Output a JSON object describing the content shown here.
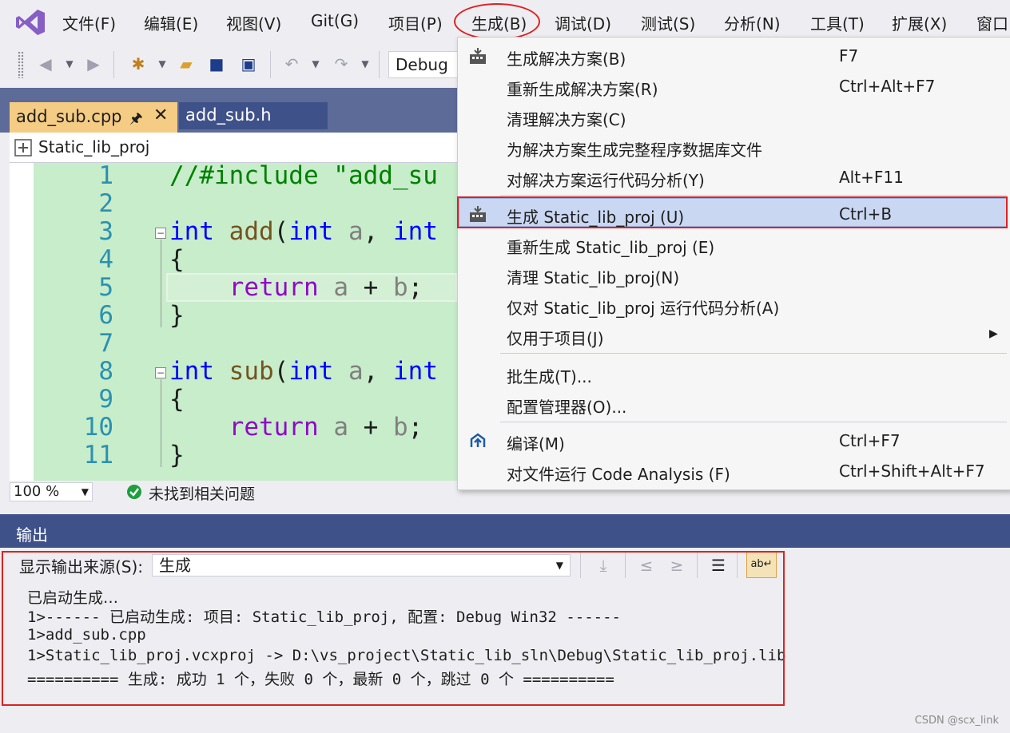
{
  "menubar": {
    "items": [
      "文件(F)",
      "编辑(E)",
      "视图(V)",
      "Git(G)",
      "项目(P)",
      "生成(B)",
      "调试(D)",
      "测试(S)",
      "分析(N)",
      "工具(T)",
      "扩展(X)",
      "窗口"
    ]
  },
  "toolbar": {
    "configuration": "Debug"
  },
  "tabs": [
    {
      "label": "add_sub.cpp",
      "active": true
    },
    {
      "label": "add_sub.h",
      "active": false
    }
  ],
  "navbar": {
    "project": "Static_lib_proj"
  },
  "editor": {
    "line_numbers": [
      "1",
      "2",
      "3",
      "4",
      "5",
      "6",
      "7",
      "8",
      "9",
      "10",
      "11"
    ]
  },
  "status": {
    "zoom": "100 %",
    "issues": "未找到相关问题"
  },
  "output": {
    "title": "输出",
    "source_label": "显示输出来源(S):",
    "source_value": "生成",
    "lines": [
      "已启动生成…",
      "1>------ 已启动生成: 项目: Static_lib_proj, 配置: Debug Win32 ------",
      "1>add_sub.cpp",
      "1>Static_lib_proj.vcxproj -> D:\\vs_project\\Static_lib_sln\\Debug\\Static_lib_proj.lib",
      "========== 生成: 成功 1 个，失败 0 个，最新 0 个，跳过 0 个 =========="
    ]
  },
  "build_menu": {
    "items": [
      {
        "label": "生成解决方案(B)",
        "shortcut": "F7"
      },
      {
        "label": "重新生成解决方案(R)",
        "shortcut": "Ctrl+Alt+F7"
      },
      {
        "label": "清理解决方案(C)",
        "shortcut": ""
      },
      {
        "label": "为解决方案生成完整程序数据库文件",
        "shortcut": ""
      },
      {
        "label": "对解决方案运行代码分析(Y)",
        "shortcut": "Alt+F11"
      },
      {
        "label": "生成 Static_lib_proj (U)",
        "shortcut": "Ctrl+B"
      },
      {
        "label": "重新生成 Static_lib_proj (E)",
        "shortcut": ""
      },
      {
        "label": "清理 Static_lib_proj(N)",
        "shortcut": ""
      },
      {
        "label": "仅对 Static_lib_proj 运行代码分析(A)",
        "shortcut": ""
      },
      {
        "label": "仅用于项目(J)",
        "shortcut": ""
      },
      {
        "label": "批生成(T)...",
        "shortcut": ""
      },
      {
        "label": "配置管理器(O)...",
        "shortcut": ""
      },
      {
        "label": "编译(M)",
        "shortcut": "Ctrl+F7"
      },
      {
        "label": "对文件运行 Code Analysis (F)",
        "shortcut": "Ctrl+Shift+Alt+F7"
      }
    ]
  },
  "watermark": "CSDN @scx_link",
  "colors": {
    "accent_tab": "#f5cc84",
    "header_blue": "#3f5189",
    "highlight_box": "#e02020",
    "code_bg": "#c7edcb"
  }
}
